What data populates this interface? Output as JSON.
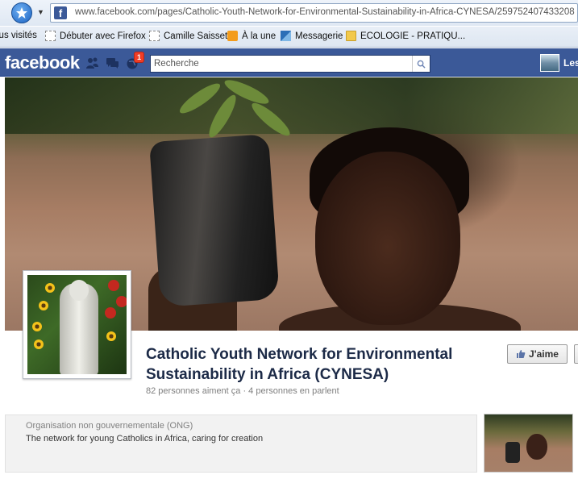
{
  "browser": {
    "url": "www.facebook.com/pages/Catholic-Youth-Network-for-Environmental-Sustainability-in-Africa-CYNESA/259752407433208",
    "favicon_letter": "f",
    "bookmarks": [
      {
        "label": "lus visités",
        "icon": "none"
      },
      {
        "label": "Débuter avec Firefox",
        "icon": "dashed-square-icon"
      },
      {
        "label": "Camille Saisset",
        "icon": "dashed-square-icon"
      },
      {
        "label": "À la une",
        "icon": "rss-icon"
      },
      {
        "label": "Messagerie",
        "icon": "mail-icon"
      },
      {
        "label": "ECOLOGIE - PRATIQU...",
        "icon": "folder-icon"
      }
    ]
  },
  "fbbar": {
    "logo": "facebook",
    "notification_count": "1",
    "search_placeholder": "Recherche",
    "user_name": "Les"
  },
  "page": {
    "title": "Catholic Youth Network for Environmental Sustainability in Africa (CYNESA)",
    "meta": "82 personnes aiment ça · 4 personnes en parlent",
    "like_label": "J'aime",
    "category": "Organisation non gouvernementale (ONG)",
    "description": "The network for young Catholics in Africa, caring for creation"
  },
  "colors": {
    "facebook_blue": "#3b5998",
    "title_color": "#1c2a47",
    "notification_red": "#f03d25"
  }
}
